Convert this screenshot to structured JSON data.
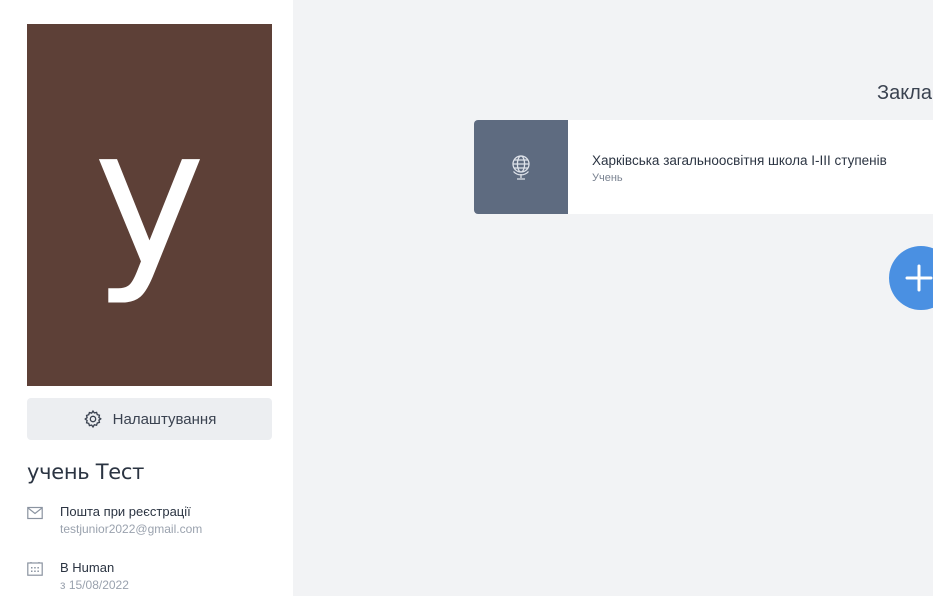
{
  "profile": {
    "avatar_letter": "у",
    "avatar_color": "#5d4037",
    "settings_label": "Налаштування",
    "settings_icon": "gear-icon",
    "name": "учень Тест",
    "email_title": "Пошта при реєстрації",
    "email": "testjunior2022@gmail.com",
    "email_icon": "mail-icon",
    "since_title": "В Human",
    "since_date": "з 15/08/2022",
    "since_icon": "calendar-icon"
  },
  "main": {
    "title": "Закла",
    "schools": [
      {
        "name": "Харківська загальноосвітня школа І-ІІІ ступенів",
        "role": "Учень",
        "icon": "globe-icon",
        "icon_bg": "#5e6b80"
      }
    ],
    "add_button_icon": "plus-icon",
    "accent": "#4a90e2"
  }
}
